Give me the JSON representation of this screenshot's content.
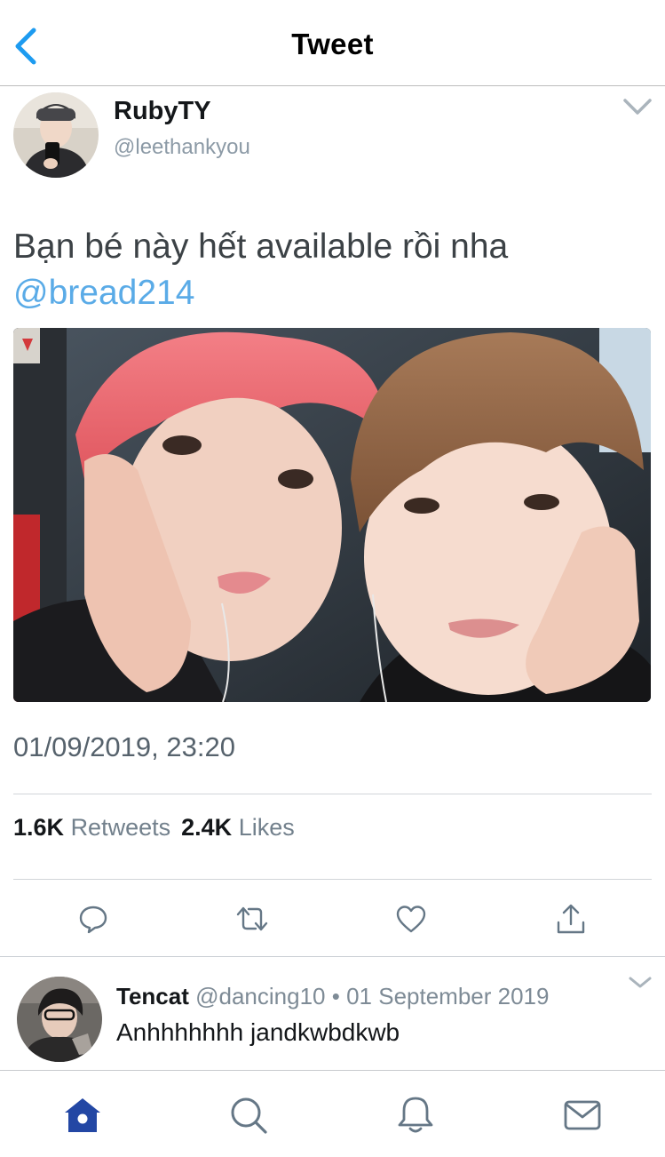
{
  "colors": {
    "accent": "#1d9bf0",
    "mention": "#5aabe7",
    "tab_active": "#2347a4",
    "text_secondary": "#8c9aa6"
  },
  "nav": {
    "title": "Tweet",
    "back_icon": "chevron-left-icon"
  },
  "tweet": {
    "author_name": "RubyTY",
    "author_handle": "@leethankyou",
    "text": "Bạn bé này hết available rồi nha ",
    "mention": "@bread214",
    "media_description_icon": "photo",
    "timestamp": "01/09/2019, 23:20",
    "retweets_count": "1.6K",
    "retweets_label": "Retweets",
    "likes_count": "2.4K",
    "likes_label": "Likes",
    "actions": [
      "reply-icon",
      "retweet-icon",
      "like-icon",
      "share-icon"
    ]
  },
  "reply": {
    "name": "Tencat",
    "handle": "@dancing10",
    "separator": "•",
    "date": "01 September 2019",
    "text": "Anhhhhhhh jandkwbdkwb"
  },
  "tabbar": {
    "items": [
      "home-icon",
      "search-icon",
      "notifications-icon",
      "messages-icon"
    ],
    "active": "home-icon"
  }
}
